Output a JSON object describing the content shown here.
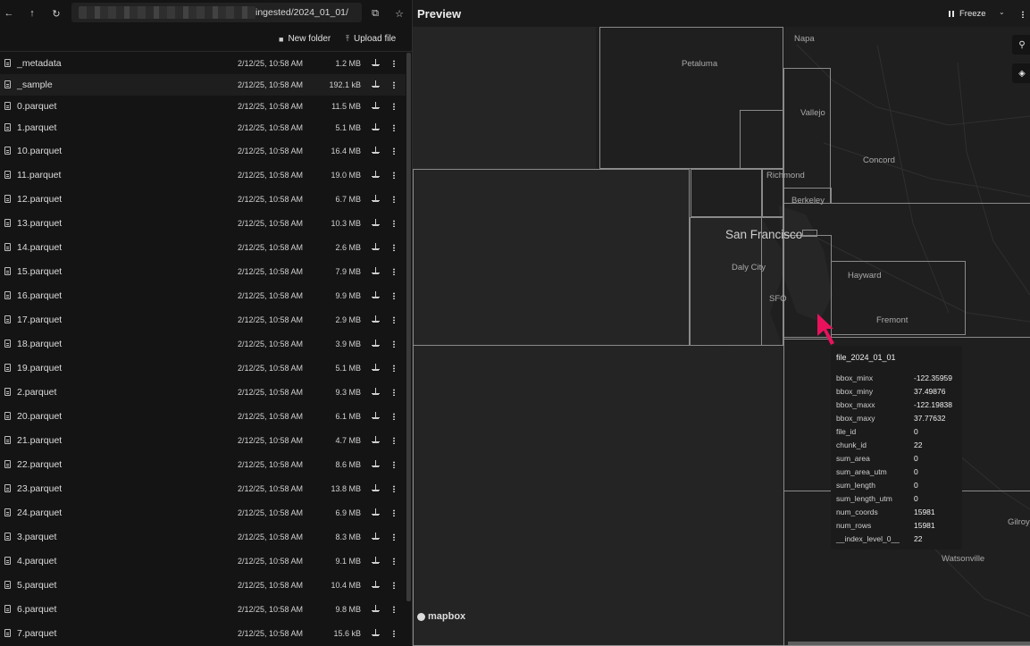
{
  "nav": {
    "path_suffix": "ingested/2024_01_01/"
  },
  "toolbar": {
    "new_folder_label": "New folder",
    "upload_file_label": "Upload file"
  },
  "files": [
    {
      "name": "_metadata",
      "date": "2/12/25, 10:58 AM",
      "size": "1.2 MB"
    },
    {
      "name": "_sample",
      "date": "2/12/25, 10:58 AM",
      "size": "192.1 kB"
    },
    {
      "name": "0.parquet",
      "date": "2/12/25, 10:58 AM",
      "size": "11.5 MB"
    },
    {
      "name": "1.parquet",
      "date": "2/12/25, 10:58 AM",
      "size": "5.1 MB"
    },
    {
      "name": "10.parquet",
      "date": "2/12/25, 10:58 AM",
      "size": "16.4 MB"
    },
    {
      "name": "11.parquet",
      "date": "2/12/25, 10:58 AM",
      "size": "19.0 MB"
    },
    {
      "name": "12.parquet",
      "date": "2/12/25, 10:58 AM",
      "size": "6.7 MB"
    },
    {
      "name": "13.parquet",
      "date": "2/12/25, 10:58 AM",
      "size": "10.3 MB"
    },
    {
      "name": "14.parquet",
      "date": "2/12/25, 10:58 AM",
      "size": "2.6 MB"
    },
    {
      "name": "15.parquet",
      "date": "2/12/25, 10:58 AM",
      "size": "7.9 MB"
    },
    {
      "name": "16.parquet",
      "date": "2/12/25, 10:58 AM",
      "size": "9.9 MB"
    },
    {
      "name": "17.parquet",
      "date": "2/12/25, 10:58 AM",
      "size": "2.9 MB"
    },
    {
      "name": "18.parquet",
      "date": "2/12/25, 10:58 AM",
      "size": "3.9 MB"
    },
    {
      "name": "19.parquet",
      "date": "2/12/25, 10:58 AM",
      "size": "5.1 MB"
    },
    {
      "name": "2.parquet",
      "date": "2/12/25, 10:58 AM",
      "size": "9.3 MB"
    },
    {
      "name": "20.parquet",
      "date": "2/12/25, 10:58 AM",
      "size": "6.1 MB"
    },
    {
      "name": "21.parquet",
      "date": "2/12/25, 10:58 AM",
      "size": "4.7 MB"
    },
    {
      "name": "22.parquet",
      "date": "2/12/25, 10:58 AM",
      "size": "8.6 MB"
    },
    {
      "name": "23.parquet",
      "date": "2/12/25, 10:58 AM",
      "size": "13.8 MB"
    },
    {
      "name": "24.parquet",
      "date": "2/12/25, 10:58 AM",
      "size": "6.9 MB"
    },
    {
      "name": "3.parquet",
      "date": "2/12/25, 10:58 AM",
      "size": "8.3 MB"
    },
    {
      "name": "4.parquet",
      "date": "2/12/25, 10:58 AM",
      "size": "9.1 MB"
    },
    {
      "name": "5.parquet",
      "date": "2/12/25, 10:58 AM",
      "size": "10.4 MB"
    },
    {
      "name": "6.parquet",
      "date": "2/12/25, 10:58 AM",
      "size": "9.8 MB"
    },
    {
      "name": "7.parquet",
      "date": "2/12/25, 10:58 AM",
      "size": "15.6 kB"
    }
  ],
  "preview": {
    "title": "Preview",
    "freeze_label": "Freeze"
  },
  "map": {
    "places": [
      "Napa",
      "Petaluma",
      "Vallejo",
      "Concord",
      "Richmond",
      "Berkeley",
      "San Francisco",
      "Daly City",
      "SFO",
      "Hayward",
      "Fremont",
      "Watsonville",
      "Gilroy"
    ],
    "attribution": "mapbox"
  },
  "tooltip": {
    "title": "file_2024_01_01",
    "rows": [
      {
        "key": "bbox_minx",
        "value": "-122.35959"
      },
      {
        "key": "bbox_miny",
        "value": "37.49876"
      },
      {
        "key": "bbox_maxx",
        "value": "-122.19838"
      },
      {
        "key": "bbox_maxy",
        "value": "37.77632"
      },
      {
        "key": "file_id",
        "value": "0"
      },
      {
        "key": "chunk_id",
        "value": "22"
      },
      {
        "key": "sum_area",
        "value": "0"
      },
      {
        "key": "sum_area_utm",
        "value": "0"
      },
      {
        "key": "sum_length",
        "value": "0"
      },
      {
        "key": "sum_length_utm",
        "value": "0"
      },
      {
        "key": "num_coords",
        "value": "15981"
      },
      {
        "key": "num_rows",
        "value": "15981"
      },
      {
        "key": "__index_level_0__",
        "value": "22"
      }
    ]
  },
  "colors": {
    "cursor": "#e8125c",
    "map_background": "#1d1d1e",
    "water": "#262627",
    "bbox_outline": "#8a8a8a"
  }
}
